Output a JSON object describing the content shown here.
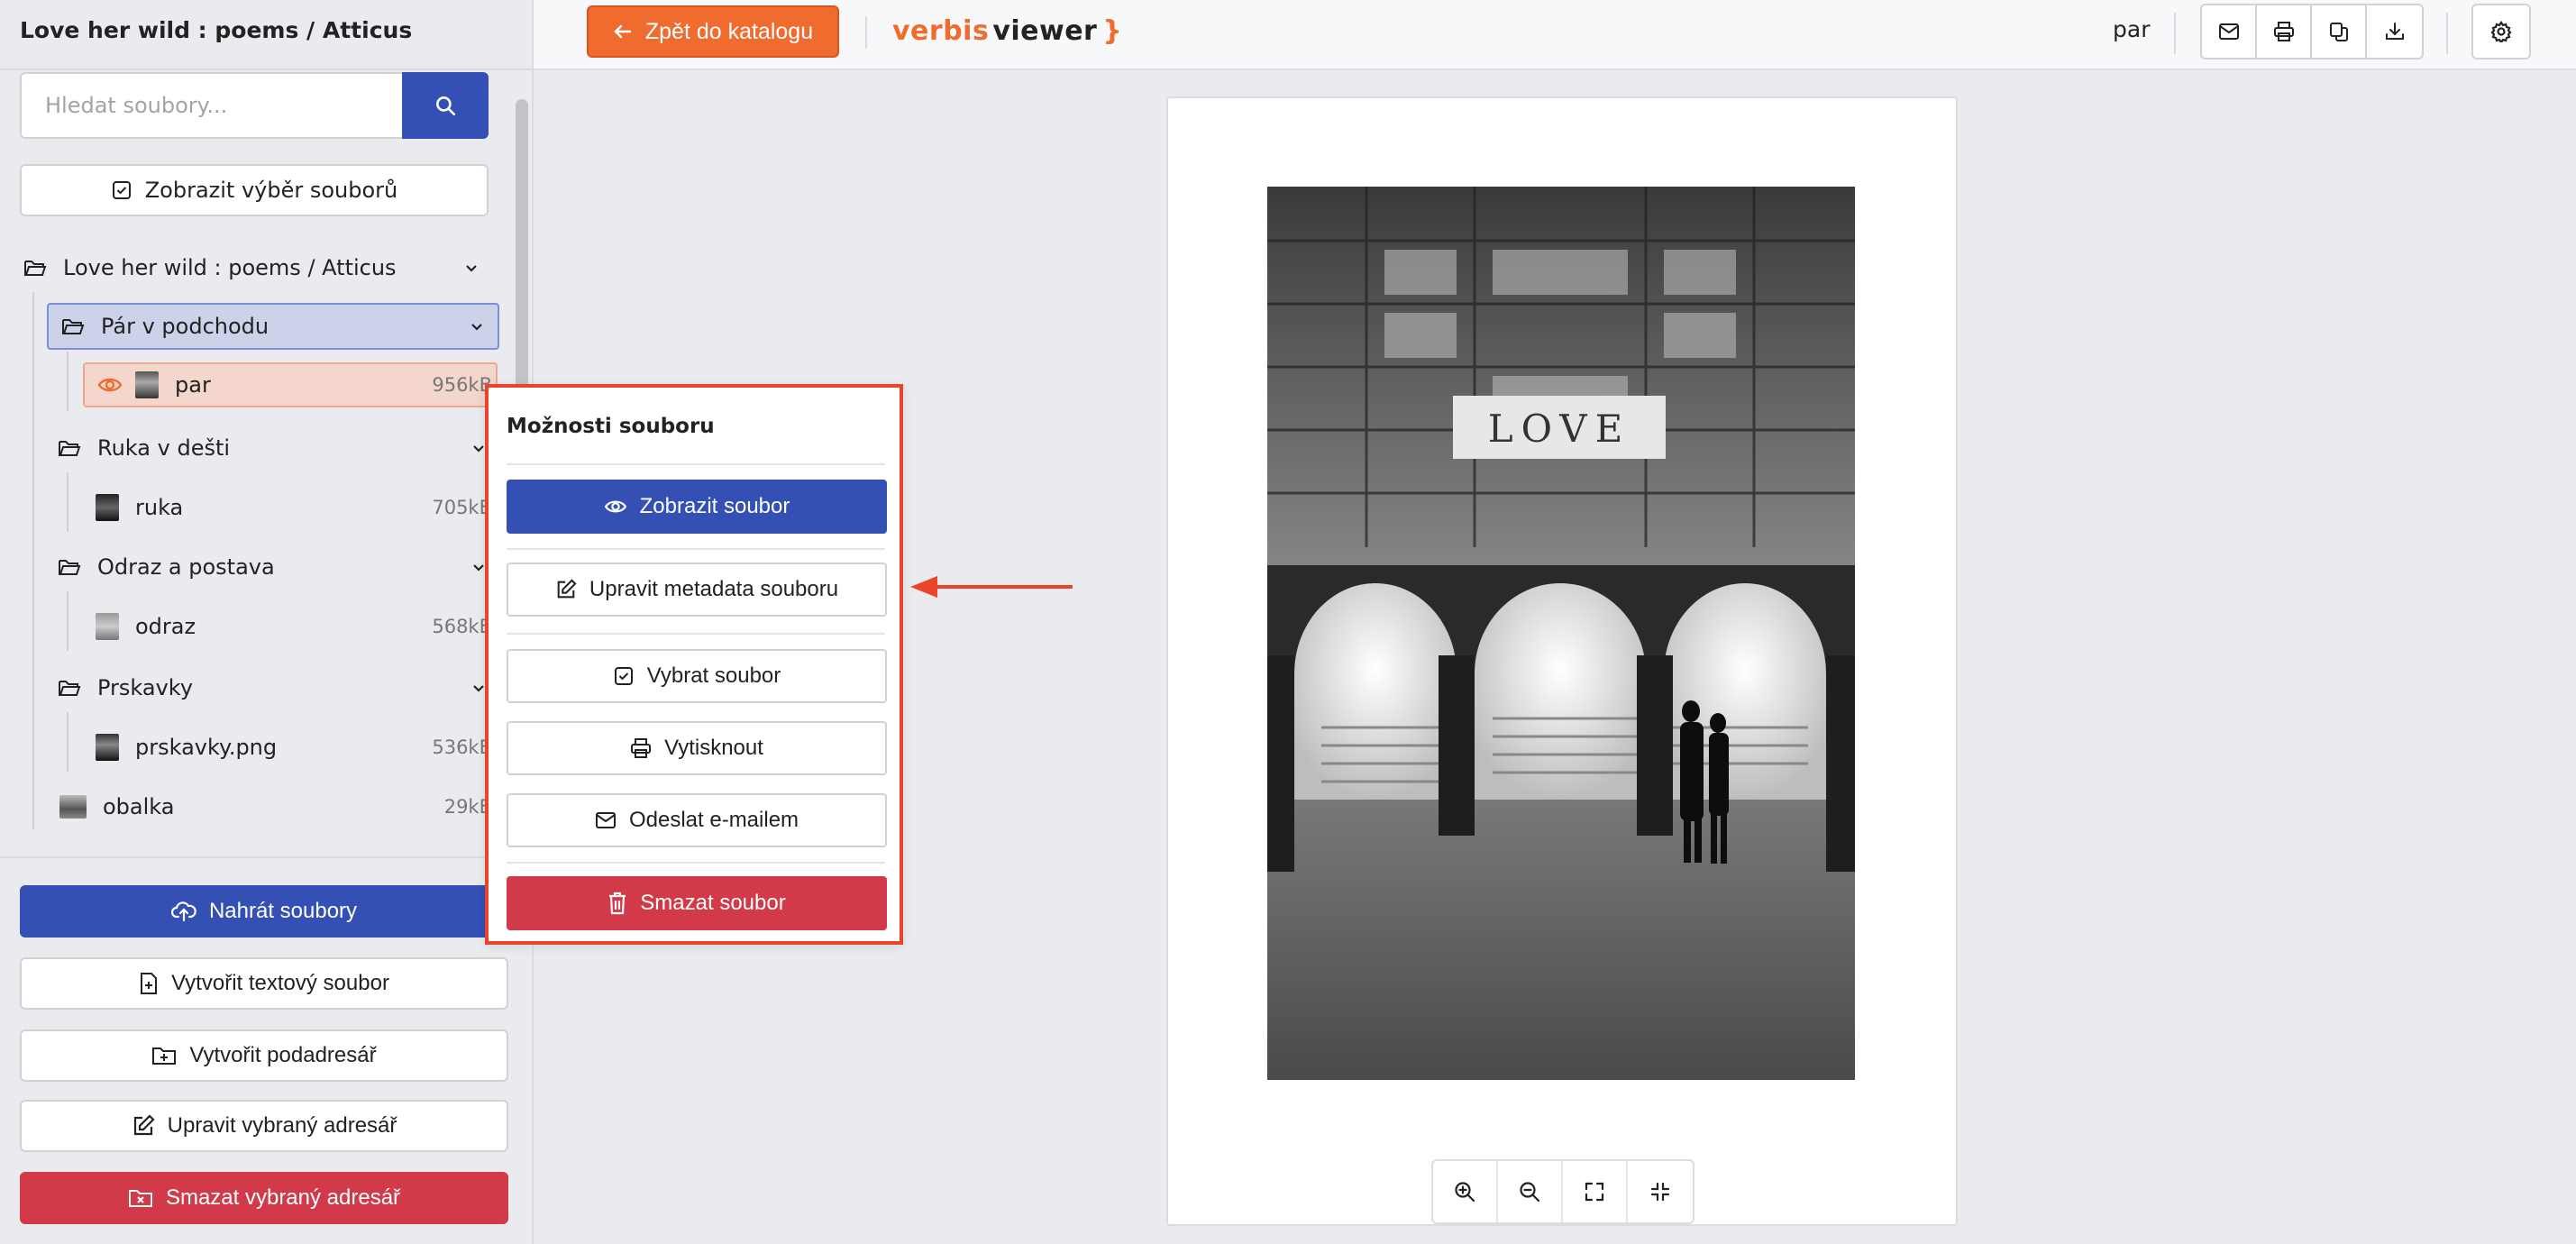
{
  "sidebar": {
    "title": "Love her wild : poems / Atticus",
    "search_placeholder": "Hledat soubory...",
    "show_selection_label": "Zobrazit výběr souborů",
    "tree": {
      "root_folder": "Love her wild : poems / Atticus",
      "folders": [
        {
          "name": "Pár v podchodu",
          "file": {
            "name": "par",
            "size": "956kB"
          }
        },
        {
          "name": "Ruka v dešti",
          "file": {
            "name": "ruka",
            "size": "705kB"
          }
        },
        {
          "name": "Odraz a postava",
          "file": {
            "name": "odraz",
            "size": "568kB"
          }
        },
        {
          "name": "Prskavky",
          "file": {
            "name": "prskavky.png",
            "size": "536kB"
          }
        }
      ],
      "root_file": {
        "name": "obalka",
        "size": "29kB"
      }
    },
    "buttons": {
      "upload": "Nahrát soubory",
      "create_text": "Vytvořit textový soubor",
      "create_subdir": "Vytvořit podadresář",
      "edit_dir": "Upravit vybraný adresář",
      "delete_dir": "Smazat vybraný adresář"
    }
  },
  "topbar": {
    "back_label": "Zpět do katalogu",
    "logo_part1": "verbis",
    "logo_part2": "viewer",
    "logo_part3": "}",
    "current_file": "par",
    "actions": [
      "mail-icon",
      "print-icon",
      "copy-icon",
      "download-icon"
    ],
    "settings_icon": "gear-icon"
  },
  "viewer": {
    "image_text": "LOVE",
    "zoom_controls": [
      "zoom-in-icon",
      "zoom-out-icon",
      "fullscreen-icon",
      "fit-icon"
    ]
  },
  "popup": {
    "title": "Možnosti souboru",
    "view": "Zobrazit soubor",
    "edit_metadata": "Upravit metadata souboru",
    "select": "Vybrat soubor",
    "print": "Vytisknout",
    "email": "Odeslat e-mailem",
    "delete": "Smazat soubor"
  },
  "colors": {
    "primary": "#3450b5",
    "accent": "#f06b2e",
    "danger": "#d23a4a",
    "highlight_border": "#e8452a"
  }
}
